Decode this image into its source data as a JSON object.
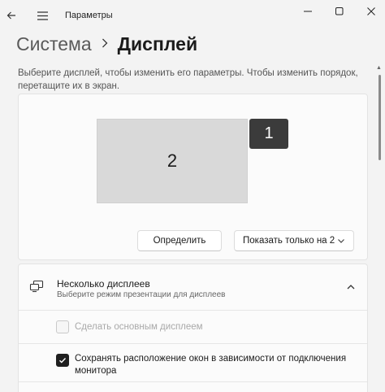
{
  "app": {
    "title": "Параметры"
  },
  "breadcrumb": {
    "parent": "Система",
    "current": "Дисплей"
  },
  "description": "Выберите дисплей, чтобы изменить его параметры. Чтобы изменить порядок, перетащите их в экран.",
  "arrangement": {
    "monitors": [
      {
        "label": "1",
        "selected": true
      },
      {
        "label": "2",
        "selected": false
      }
    ],
    "identify_label": "Определить",
    "show_dropdown_value": "Показать только на 2"
  },
  "multiple_displays": {
    "title": "Несколько дисплеев",
    "subtitle": "Выберите режим презентации для дисплеев",
    "expanded": true,
    "options": [
      {
        "label": "Сделать основным дисплеем",
        "checked": false,
        "disabled": true
      },
      {
        "label": "Сохранять расположение окон в зависимости от подключения монитора",
        "checked": true,
        "disabled": false
      }
    ]
  },
  "icons": {
    "back": "back-arrow-icon",
    "menu": "hamburger-menu-icon",
    "minimize": "minimize-icon",
    "maximize": "maximize-icon",
    "close": "close-icon",
    "multiple_displays": "multiple-monitors-icon",
    "collapse": "chevron-up-icon",
    "dropdown": "chevron-down-icon"
  },
  "colors": {
    "window_bg": "#f3f3f3",
    "card_bg": "#fbfbfb",
    "monitor_selected": "#3b3b3b",
    "monitor_other": "#d9d9d9"
  }
}
